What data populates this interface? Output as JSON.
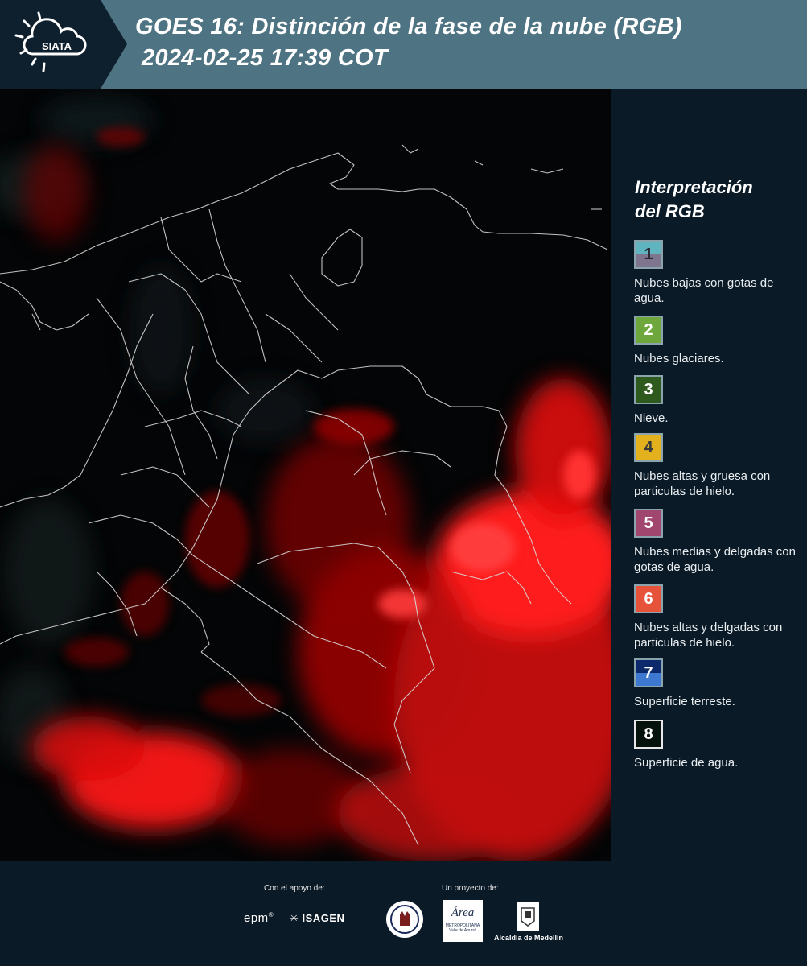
{
  "header": {
    "logo_text": "SIATA",
    "title_line1": "GOES 16: Distinción de la fase de la nube (RGB)",
    "title_line2": "2024-02-25 17:39 COT"
  },
  "map": {
    "icon": "satellite-rgb-cloud-phase-map"
  },
  "legend": {
    "title_line1": "Interpretación",
    "title_line2": "del RGB",
    "items": [
      {
        "number": "1",
        "label": "Nubes bajas con gotas de agua.",
        "color_top": "#5fb4c0",
        "color_bottom": "#7f758f",
        "number_color": "#2a2a35"
      },
      {
        "number": "2",
        "label": "Nubes glaciares.",
        "color_top": "#6ea83c",
        "color_bottom": "#6ea83c",
        "number_color": "#ffffff"
      },
      {
        "number": "3",
        "label": "Nieve.",
        "color_top": "#2e5a1e",
        "color_bottom": "#2e5a1e",
        "number_color": "#ffffff"
      },
      {
        "number": "4",
        "label": "Nubes altas y gruesa con particulas de hielo.",
        "color_top": "#e4b11e",
        "color_bottom": "#e4b11e",
        "number_color": "#3a3a3a"
      },
      {
        "number": "5",
        "label": "Nubes medias y delgadas con gotas de agua.",
        "color_top": "#a0466f",
        "color_bottom": "#a0466f",
        "number_color": "#ffffff"
      },
      {
        "number": "6",
        "label": "Nubes altas y delgadas con particulas de hielo.",
        "color_top": "#e7533a",
        "color_bottom": "#e7533a",
        "number_color": "#ffffff"
      },
      {
        "number": "7",
        "label": "Superficie terreste.",
        "color_top": "#0c2a6b",
        "color_bottom": "#3e79d1",
        "number_color": "#ffffff"
      },
      {
        "number": "8",
        "label": "Superficie de agua.",
        "color_top": "#06120c",
        "color_bottom": "#06120c",
        "number_color": "#ffffff"
      }
    ]
  },
  "footer": {
    "support_caption": "Con el apoyo de:",
    "project_caption": "Un proyecto de:",
    "sponsor1": "epm",
    "sponsor2": "ISAGEN",
    "partner_metro_name": "Área",
    "partner_metro_sub": "METROPOLITANA",
    "partner_metro_sub2": "Valle de Aburrá",
    "partner_alcaldia": "Alcaldía de Medellín"
  }
}
